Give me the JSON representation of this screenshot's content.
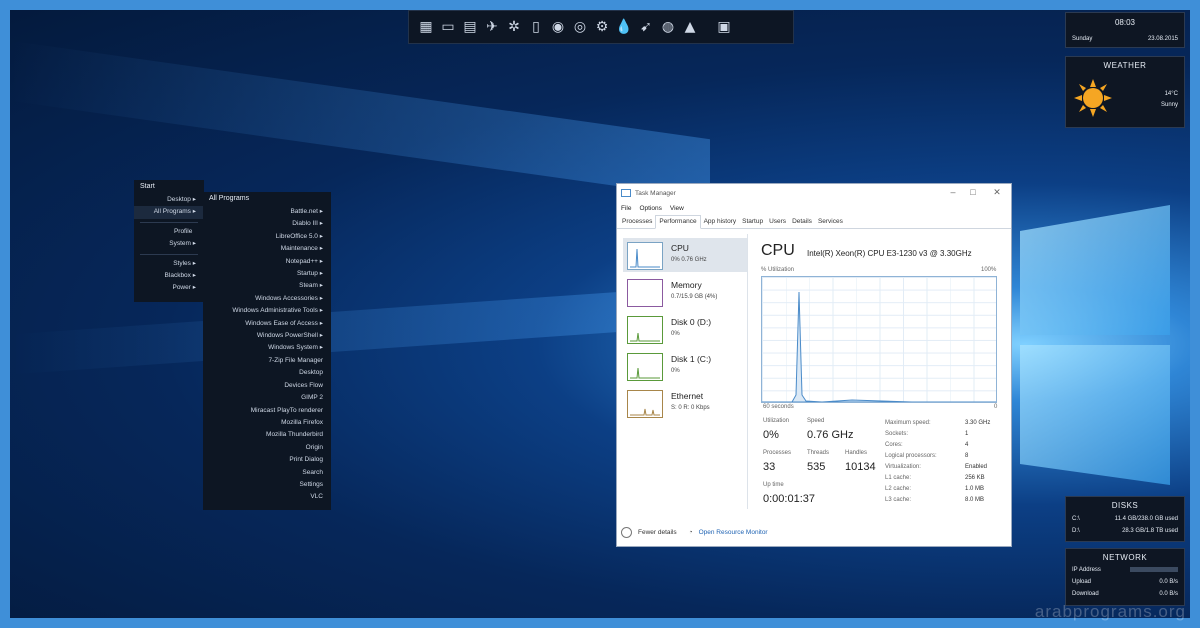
{
  "dock": {
    "icons": [
      "terminal-icon",
      "window-icon",
      "folder-icon",
      "plane-icon",
      "gear-network-icon",
      "document-icon",
      "globe-icon",
      "chrome-icon",
      "settings-icon",
      "droplet-icon",
      "bird-icon",
      "steam-icon",
      "vlc-cone-icon",
      "monitor-icon"
    ]
  },
  "clock": {
    "time": "08:03",
    "day": "Sunday",
    "date": "23.08.2015"
  },
  "weather": {
    "title": "WEATHER",
    "temp": "14°C",
    "condition": "Sunny",
    "color": "#f5a623"
  },
  "disks": {
    "title": "DISKS",
    "items": [
      {
        "drive": "C:\\",
        "value": "11.4 GB/238.0 GB used"
      },
      {
        "drive": "D:\\",
        "value": "28.3 GB/1.8 TB used"
      }
    ]
  },
  "network": {
    "title": "NETWORK",
    "rows": [
      {
        "label": "IP Address",
        "value": ""
      },
      {
        "label": "Upload",
        "value": "0.0 B/s"
      },
      {
        "label": "Download",
        "value": "0.0 B/s"
      }
    ]
  },
  "start_menu": {
    "title": "Start",
    "group1": [
      "Desktop",
      "All Programs"
    ],
    "group2": [
      "Profile",
      "System"
    ],
    "group3": [
      "Styles",
      "Blackbox",
      "Power"
    ]
  },
  "programs": {
    "title": "All Programs",
    "items": [
      "Battle.net",
      "Diablo III",
      "LibreOffice 5.0",
      "Maintenance",
      "Notepad++",
      "Startup",
      "Steam",
      "Windows Accessories",
      "Windows Administrative Tools",
      "Windows Ease of Access",
      "Windows PowerShell",
      "Windows System",
      "7-Zip File Manager",
      "Desktop",
      "Devices Flow",
      "GIMP 2",
      "Miracast PlayTo renderer",
      "Mozilla Firefox",
      "Mozilla Thunderbird",
      "Origin",
      "Print Dialog",
      "Search",
      "Settings",
      "VLC"
    ]
  },
  "taskmanager": {
    "title": "Task Manager",
    "menus": [
      "File",
      "Options",
      "View"
    ],
    "tabs": [
      "Processes",
      "Performance",
      "App history",
      "Startup",
      "Users",
      "Details",
      "Services"
    ],
    "side": [
      {
        "name": "CPU",
        "value": "0%  0.76 GHz"
      },
      {
        "name": "Memory",
        "value": "0.7/15.9 GB (4%)"
      },
      {
        "name": "Disk 0 (D:)",
        "value": "0%"
      },
      {
        "name": "Disk 1 (C:)",
        "value": "0%"
      },
      {
        "name": "Ethernet",
        "value": "S: 0  R: 0 Kbps"
      }
    ],
    "header": "CPU",
    "cpu_model": "Intel(R) Xeon(R) CPU E3-1230 v3 @ 3.30GHz",
    "util_label": "% Utilization",
    "util_max": "100%",
    "time_left": "60 seconds",
    "time_right": "0",
    "stats": {
      "utilization_label": "Utilization",
      "utilization": "0%",
      "speed_label": "Speed",
      "speed": "0.76 GHz",
      "processes_label": "Processes",
      "processes": "33",
      "threads_label": "Threads",
      "threads": "535",
      "handles_label": "Handles",
      "handles": "10134",
      "uptime_label": "Up time",
      "uptime": "0:00:01:37"
    },
    "specs": [
      {
        "k": "Maximum speed:",
        "v": "3.30 GHz"
      },
      {
        "k": "Sockets:",
        "v": "1"
      },
      {
        "k": "Cores:",
        "v": "4"
      },
      {
        "k": "Logical processors:",
        "v": "8"
      },
      {
        "k": "Virtualization:",
        "v": "Enabled"
      },
      {
        "k": "L1 cache:",
        "v": "256 KB"
      },
      {
        "k": "L2 cache:",
        "v": "1.0 MB"
      },
      {
        "k": "L3 cache:",
        "v": "8.0 MB"
      }
    ],
    "fewer_details": "Fewer details",
    "resource_monitor": "Open Resource Monitor"
  },
  "watermark": "arabprograms.org"
}
